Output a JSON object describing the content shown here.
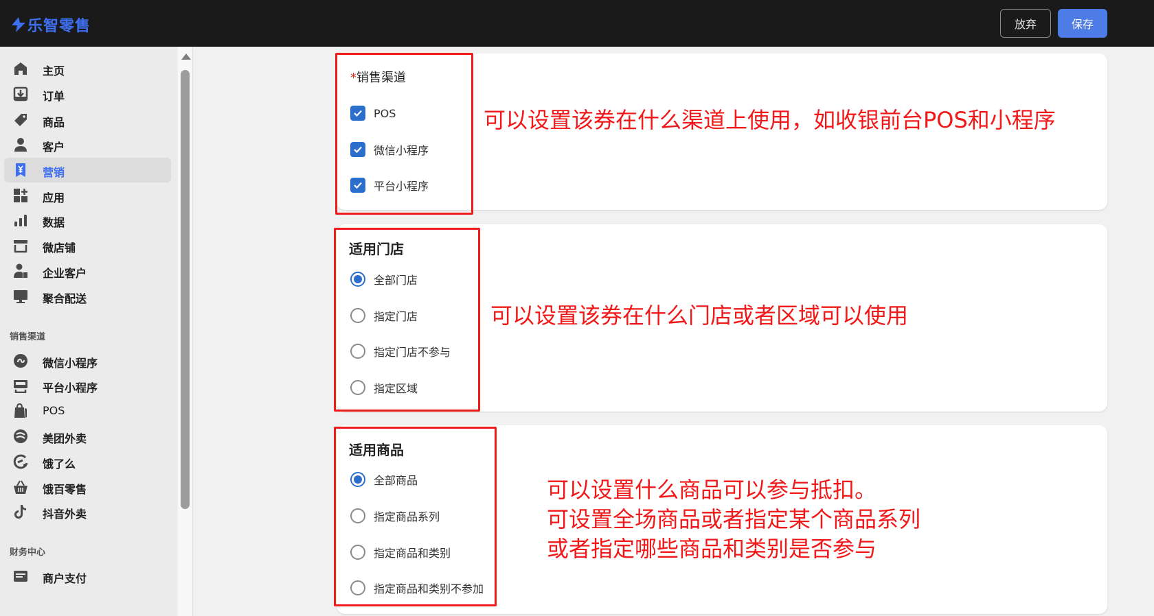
{
  "header": {
    "logo_text": "乐智零售",
    "discard_label": "放弃",
    "save_label": "保存",
    "brand_color": "#3d6ff0"
  },
  "sidebar": {
    "items": [
      {
        "label": "主页",
        "icon": "home-icon"
      },
      {
        "label": "订单",
        "icon": "order-download-icon"
      },
      {
        "label": "商品",
        "icon": "tag-icon"
      },
      {
        "label": "客户",
        "icon": "person-icon"
      },
      {
        "label": "营销",
        "icon": "yuan-icon",
        "active": true
      },
      {
        "label": "应用",
        "icon": "apps-grid-icon"
      },
      {
        "label": "数据",
        "icon": "bar-chart-icon"
      },
      {
        "label": "微店铺",
        "icon": "storefront-icon"
      },
      {
        "label": "企业客户",
        "icon": "enterprise-user-icon"
      },
      {
        "label": "聚合配送",
        "icon": "monitor-icon"
      }
    ],
    "channels_title": "销售渠道",
    "channels": [
      {
        "label": "微信小程序",
        "icon": "mini-program-icon"
      },
      {
        "label": "平台小程序",
        "icon": "platform-store-icon"
      },
      {
        "label": "POS",
        "icon": "shopping-bag-icon"
      },
      {
        "label": "美团外卖",
        "icon": "meituan-icon"
      },
      {
        "label": "饿了么",
        "icon": "eleme-icon"
      },
      {
        "label": "饿百零售",
        "icon": "basket-icon"
      },
      {
        "label": "抖音外卖",
        "icon": "tiktok-icon"
      }
    ],
    "finance_title": "财务中心",
    "finance_items": [
      {
        "label": "商户支付",
        "icon": "payment-icon"
      }
    ]
  },
  "sales_channel": {
    "required_mark": "*",
    "title": "销售渠道",
    "options": [
      {
        "label": "POS",
        "checked": true
      },
      {
        "label": "微信小程序",
        "checked": true
      },
      {
        "label": "平台小程序",
        "checked": true
      }
    ]
  },
  "stores": {
    "title": "适用门店",
    "options": [
      {
        "label": "全部门店",
        "selected": true
      },
      {
        "label": "指定门店",
        "selected": false
      },
      {
        "label": "指定门店不参与",
        "selected": false
      },
      {
        "label": "指定区域",
        "selected": false
      }
    ]
  },
  "products": {
    "title": "适用商品",
    "options": [
      {
        "label": "全部商品",
        "selected": true
      },
      {
        "label": "指定商品系列",
        "selected": false
      },
      {
        "label": "指定商品和类别",
        "selected": false
      },
      {
        "label": "指定商品和类别不参加",
        "selected": false
      }
    ]
  },
  "annotations": {
    "channel_note": "可以设置该券在什么渠道上使用，如收银前台POS和小程序",
    "store_note": "可以设置该券在什么门店或者区域可以使用",
    "product_note_1": "可以设置什么商品可以参与抵扣。",
    "product_note_2": "可设置全场商品或者指定某个商品系列",
    "product_note_3": "或者指定哪些商品和类别是否参与",
    "color": "#f01818"
  }
}
